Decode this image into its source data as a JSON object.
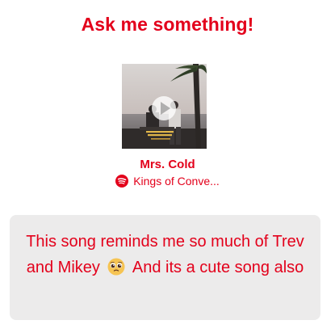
{
  "header": {
    "title": "Ask me something!"
  },
  "song": {
    "title": "Mrs. Cold",
    "artist": "Kings of Conve...",
    "source_icon": "spotify-icon",
    "cover_icon": "album-cover-image",
    "play_icon": "play-icon"
  },
  "message": {
    "text_before": "This song reminds me so much of Trev and Mikey",
    "emoji": "pleading-face-emoji",
    "text_after": "And its a cute song also"
  },
  "colors": {
    "accent": "#e3001b",
    "message_background": "#ecebeb",
    "page_background": "#ffffff"
  }
}
